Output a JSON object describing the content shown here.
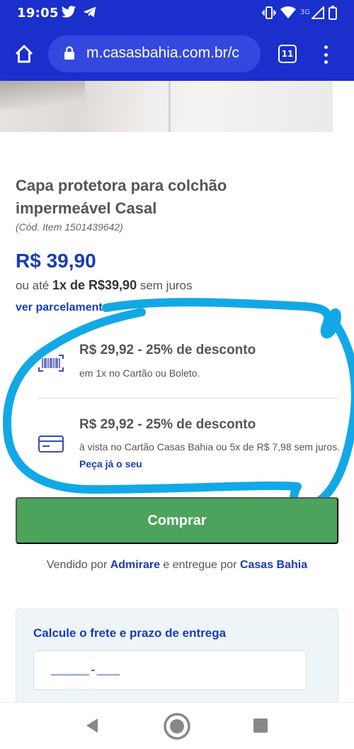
{
  "status_bar": {
    "time": "19:05",
    "network": "3G",
    "icons_left": [
      "twitter-icon",
      "telegram-icon"
    ],
    "icons_right": [
      "vibrate-icon",
      "wifi-icon",
      "signal-icon",
      "battery-icon"
    ]
  },
  "browser": {
    "url": "m.casasbahia.com.br/c",
    "tab_count": "11"
  },
  "product": {
    "title": "Capa protetora para colchão impermeável Casal",
    "code": "(Cód. Item 1501439642)",
    "price": "R$ 39,90",
    "installments_prefix": "ou até",
    "installments_value": "1x de R$39,90",
    "installments_suffix": "sem juros",
    "see_installments": "ver parcelamento"
  },
  "discounts": [
    {
      "headline": "R$ 29,92 - 25% de desconto",
      "detail": "em 1x no Cartão ou Boleto.",
      "icon": "barcode-icon"
    },
    {
      "headline": "R$ 29,92 - 25% de desconto",
      "detail": "à vista no Cartão Casas Bahia ou 5x de R$ 7,98 sem juros.",
      "link": "Peça já o seu",
      "icon": "credit-card-icon"
    }
  ],
  "buy_button": "Comprar",
  "seller": {
    "prefix": "Vendido por",
    "seller_name": "Admirare",
    "middle": "e entregue por",
    "delivery_name": "Casas Bahia"
  },
  "shipping": {
    "title": "Calcule o frete e prazo de entrega",
    "cep_placeholder": "_____-___"
  },
  "colors": {
    "brand_blue": "#1a2fcc",
    "price_blue": "#1a3bb8",
    "buy_green": "#4ca35b",
    "annotation_blue": "#12a8e6"
  }
}
